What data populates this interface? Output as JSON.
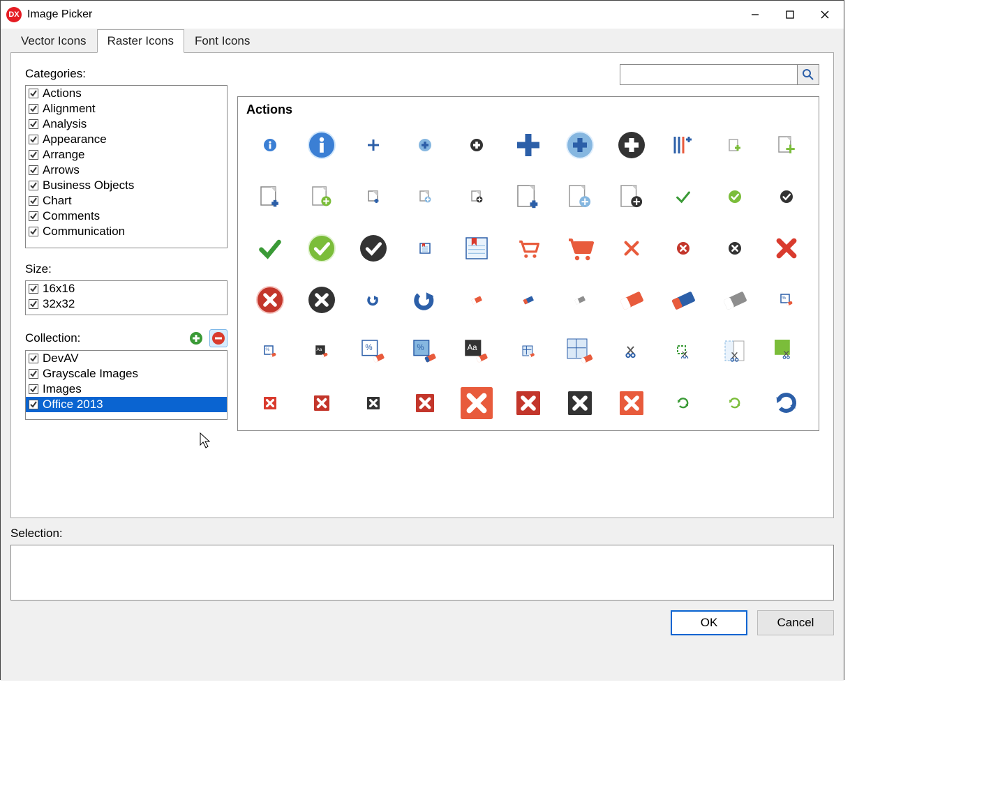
{
  "window": {
    "title": "Image Picker"
  },
  "tabs": [
    "Vector Icons",
    "Raster Icons",
    "Font Icons"
  ],
  "active_tab": 1,
  "labels": {
    "categories": "Categories:",
    "size": "Size:",
    "collection": "Collection:",
    "selection": "Selection:"
  },
  "categories": [
    {
      "label": "Actions",
      "checked": true
    },
    {
      "label": "Alignment",
      "checked": true
    },
    {
      "label": "Analysis",
      "checked": true
    },
    {
      "label": "Appearance",
      "checked": true
    },
    {
      "label": "Arrange",
      "checked": true
    },
    {
      "label": "Arrows",
      "checked": true
    },
    {
      "label": "Business Objects",
      "checked": true
    },
    {
      "label": "Chart",
      "checked": true
    },
    {
      "label": "Comments",
      "checked": true
    },
    {
      "label": "Communication",
      "checked": true
    }
  ],
  "sizes": [
    {
      "label": "16x16",
      "checked": true
    },
    {
      "label": "32x32",
      "checked": true
    }
  ],
  "collections": [
    {
      "label": "DevAV",
      "checked": true,
      "selected": false
    },
    {
      "label": "Grayscale Images",
      "checked": true,
      "selected": false
    },
    {
      "label": "Images",
      "checked": true,
      "selected": false
    },
    {
      "label": "Office 2013",
      "checked": true,
      "selected": true
    }
  ],
  "search": {
    "placeholder": ""
  },
  "icon_section": "Actions",
  "buttons": {
    "ok": "OK",
    "cancel": "Cancel"
  },
  "colors": {
    "blue": "#3b7fd4",
    "navy": "#2c5fa8",
    "green": "#3a9a36",
    "lime": "#7bbd3a",
    "darkgreen": "#2a8a2a",
    "red": "#d93b2e",
    "darkred": "#c3362b",
    "orange": "#e85b3c",
    "dark": "#333333",
    "gray": "#8e8e8e",
    "lightblue": "#86b7e0"
  },
  "icons": [
    {
      "name": "info-small",
      "type": "info",
      "fill": "blue",
      "size": 20
    },
    {
      "name": "info-large",
      "type": "info",
      "fill": "blue",
      "size": 40,
      "glow": true
    },
    {
      "name": "plus-thin",
      "type": "plus",
      "stroke": "navy",
      "size": 20
    },
    {
      "name": "plus-circle-blue-small",
      "type": "plus-circle",
      "fill": "lightblue",
      "icon": "navy",
      "size": 20
    },
    {
      "name": "plus-circle-dark-small",
      "type": "plus-circle",
      "fill": "dark",
      "icon": "#fff",
      "size": 20
    },
    {
      "name": "plus-thick",
      "type": "plus",
      "stroke": "navy",
      "size": 36,
      "thick": true
    },
    {
      "name": "plus-circle-blue-large",
      "type": "plus-circle",
      "fill": "lightblue",
      "icon": "navy",
      "size": 40,
      "glow": true
    },
    {
      "name": "plus-circle-dark-large",
      "type": "plus-circle",
      "fill": "dark",
      "icon": "#fff",
      "size": 40
    },
    {
      "name": "add-item",
      "type": "add-item",
      "size": 32
    },
    {
      "name": "add-page",
      "type": "page-plus",
      "fill": "lime",
      "size": 20
    },
    {
      "name": "page-add-green",
      "type": "page-badge",
      "badge": "lime",
      "size": 28
    },
    {
      "name": "page-add-blue",
      "type": "page-corner-plus",
      "color": "navy",
      "size": 32
    },
    {
      "name": "page-add-green-circle",
      "type": "page-badge",
      "badge": "lime",
      "size": 32,
      "circle": true
    },
    {
      "name": "page-plus-small",
      "type": "page-corner-plus",
      "color": "navy",
      "size": 20
    },
    {
      "name": "page-plus-circle-small",
      "type": "page-badge",
      "badge": "lightblue",
      "size": 20,
      "circle": true
    },
    {
      "name": "page-plus-dark-small",
      "type": "page-badge",
      "badge": "dark",
      "size": 20,
      "circle": true
    },
    {
      "name": "page-plus-large",
      "type": "page-corner-plus",
      "color": "navy",
      "size": 36
    },
    {
      "name": "page-plus-circle-large",
      "type": "page-badge",
      "badge": "lightblue",
      "size": 36,
      "circle": true
    },
    {
      "name": "page-plus-dark-large",
      "type": "page-badge",
      "badge": "dark",
      "size": 36,
      "circle": true
    },
    {
      "name": "check-thin",
      "type": "check",
      "stroke": "green",
      "size": 24
    },
    {
      "name": "check-circle-green-small",
      "type": "check-circle",
      "fill": "lime",
      "size": 20
    },
    {
      "name": "check-circle-dark-small",
      "type": "check-circle",
      "fill": "dark",
      "size": 20
    },
    {
      "name": "check-large",
      "type": "check",
      "stroke": "green",
      "size": 36,
      "thick": true
    },
    {
      "name": "check-circle-green-large",
      "type": "check-circle",
      "fill": "lime",
      "size": 40,
      "glow": true
    },
    {
      "name": "check-circle-dark-large",
      "type": "check-circle",
      "fill": "dark",
      "size": 40
    },
    {
      "name": "bookmark-page-small",
      "type": "bookmark-page",
      "size": 20
    },
    {
      "name": "bookmark-page-large",
      "type": "bookmark-page",
      "size": 36
    },
    {
      "name": "cart-outline",
      "type": "cart",
      "stroke": "orange",
      "size": 32
    },
    {
      "name": "cart-solid",
      "type": "cart",
      "fill": "orange",
      "size": 40
    },
    {
      "name": "close-x",
      "type": "x",
      "stroke": "orange",
      "size": 28
    },
    {
      "name": "x-circle-red-small",
      "type": "x-circle",
      "fill": "darkred",
      "size": 20
    },
    {
      "name": "x-circle-dark-small",
      "type": "x-circle",
      "fill": "dark",
      "size": 20
    },
    {
      "name": "x-red-large",
      "type": "x",
      "stroke": "red",
      "size": 36,
      "thick": true
    },
    {
      "name": "x-circle-red-large",
      "type": "x-circle",
      "fill": "darkred",
      "size": 40,
      "glow": true
    },
    {
      "name": "x-circle-dark-large",
      "type": "x-circle",
      "fill": "dark",
      "size": 40
    },
    {
      "name": "redo-small",
      "type": "redo",
      "stroke": "navy",
      "size": 20
    },
    {
      "name": "redo-large",
      "type": "redo",
      "stroke": "navy",
      "size": 36
    },
    {
      "name": "eraser-red-small",
      "type": "eraser",
      "fill": "orange",
      "size": 20
    },
    {
      "name": "eraser-blue-small",
      "type": "eraser",
      "fill": "navy",
      "tip": "orange",
      "size": 20
    },
    {
      "name": "eraser-gray-small",
      "type": "eraser",
      "fill": "gray",
      "size": 20
    },
    {
      "name": "eraser-red-large",
      "type": "eraser",
      "fill": "orange",
      "size": 44
    },
    {
      "name": "eraser-blue-large",
      "type": "eraser",
      "fill": "navy",
      "tip": "orange",
      "size": 44
    },
    {
      "name": "eraser-gray-large",
      "type": "eraser",
      "fill": "gray",
      "size": 44
    },
    {
      "name": "erase-percent-small",
      "type": "erase-badge",
      "text": "%",
      "size": 20
    },
    {
      "name": "erase-percent-small2",
      "type": "erase-badge",
      "text": "%",
      "size": 20
    },
    {
      "name": "erase-aa-small",
      "type": "erase-badge",
      "text": "Aa",
      "dark": true,
      "size": 20
    },
    {
      "name": "erase-percent-large",
      "type": "erase-badge",
      "text": "%",
      "size": 36
    },
    {
      "name": "erase-percent-large2",
      "type": "erase-badge",
      "text": "%",
      "size": 36,
      "blue": true
    },
    {
      "name": "erase-aa-large",
      "type": "erase-badge",
      "text": "Aa",
      "dark": true,
      "size": 36
    },
    {
      "name": "erase-grid",
      "type": "erase-grid",
      "size": 20
    },
    {
      "name": "erase-grid-large",
      "type": "erase-grid",
      "size": 40
    },
    {
      "name": "cut-small",
      "type": "scissors",
      "size": 20
    },
    {
      "name": "cut-select-small",
      "type": "scissors-sel",
      "color": "green",
      "size": 20
    },
    {
      "name": "cut-page",
      "type": "scissors-page",
      "size": 36
    },
    {
      "name": "cut-select-large",
      "type": "scissors-sel",
      "color": "lime",
      "size": 36,
      "solid": true
    },
    {
      "name": "x-square-red-small",
      "type": "x-square",
      "fill": "red",
      "size": 20
    },
    {
      "name": "x-square-red-small2",
      "type": "x-square",
      "fill": "darkred",
      "size": 24
    },
    {
      "name": "x-square-dark-small",
      "type": "x-square",
      "fill": "dark",
      "size": 20
    },
    {
      "name": "x-square-red-med",
      "type": "x-square",
      "fill": "darkred",
      "size": 28
    },
    {
      "name": "x-square-red-big",
      "type": "x-square",
      "fill": "orange",
      "size": 48
    },
    {
      "name": "x-square-red-large",
      "type": "x-square",
      "fill": "darkred",
      "size": 36
    },
    {
      "name": "x-square-dark-large",
      "type": "x-square",
      "fill": "dark",
      "size": 36
    },
    {
      "name": "x-square-orange-large",
      "type": "x-square",
      "fill": "orange",
      "size": 36
    },
    {
      "name": "refresh-green-small",
      "type": "refresh",
      "stroke": "green",
      "size": 20
    },
    {
      "name": "refresh-green-small2",
      "type": "refresh",
      "stroke": "lime",
      "size": 20
    },
    {
      "name": "refresh-blue-large",
      "type": "refresh",
      "stroke": "navy",
      "size": 36,
      "thick": true
    },
    {
      "name": "refresh-green-large",
      "type": "refresh",
      "stroke": "lime",
      "size": 40,
      "thick": true,
      "glow": true
    },
    {
      "name": "forward-grid-small",
      "type": "forward-grid",
      "size": 24
    },
    {
      "name": "forward-grid-large",
      "type": "forward-grid",
      "size": 40
    },
    {
      "name": "page-money",
      "type": "page-money",
      "size": 24
    }
  ]
}
